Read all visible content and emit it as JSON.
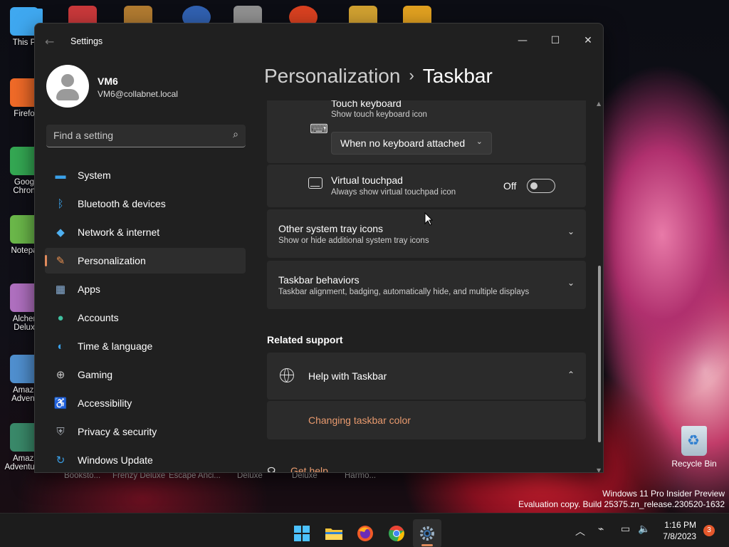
{
  "desktop": {
    "left_icons": [
      {
        "label": "This P",
        "color": "#3fa8f0"
      },
      {
        "label": "Firefo",
        "color": "#f06a28"
      },
      {
        "label": "Goog Chron",
        "color": "#34a853"
      },
      {
        "label": "Notepa",
        "color": "#6bb84a"
      },
      {
        "label": "Alcher Delux",
        "color": "#b070c0"
      },
      {
        "label": "Amazi Advent",
        "color": "#5090d0"
      },
      {
        "label": "Amazi Adventur...",
        "color": "#3a8a6a"
      }
    ],
    "bottom_labels": [
      "Booksto...",
      "Frenzy Deluxe",
      "Escape Anci...",
      "Deluxe",
      "Deluxe",
      "Harmo..."
    ],
    "recycle_bin": "Recycle Bin",
    "watermark_line1": "Windows 11 Pro Insider Preview",
    "watermark_line2": "Evaluation copy. Build 25375.zn_release.230520-1632"
  },
  "window": {
    "app_title": "Settings",
    "controls": {
      "minimize": "—",
      "maximize": "☐",
      "close": "✕"
    }
  },
  "profile": {
    "name": "VM6",
    "email": "VM6@collabnet.local"
  },
  "search": {
    "placeholder": "Find a setting"
  },
  "sidebar": {
    "items": [
      {
        "label": "System",
        "icon": "▬",
        "color": "#3aa0e8"
      },
      {
        "label": "Bluetooth & devices",
        "icon": "ᛒ",
        "color": "#3aa0e8"
      },
      {
        "label": "Network & internet",
        "icon": "◆",
        "color": "#4fb0f0"
      },
      {
        "label": "Personalization",
        "icon": "✎",
        "color": "#e89050"
      },
      {
        "label": "Apps",
        "icon": "▦",
        "color": "#8ab0d8"
      },
      {
        "label": "Accounts",
        "icon": "●",
        "color": "#40c0a0"
      },
      {
        "label": "Time & language",
        "icon": "◐",
        "color": "#3aa0e8"
      },
      {
        "label": "Gaming",
        "icon": "⊕",
        "color": "#c8c8c8"
      },
      {
        "label": "Accessibility",
        "icon": "♿",
        "color": "#3aa0e8"
      },
      {
        "label": "Privacy & security",
        "icon": "⛨",
        "color": "#9aa0a8"
      },
      {
        "label": "Windows Update",
        "icon": "↻",
        "color": "#3aa0e8"
      }
    ],
    "active_index": 3
  },
  "breadcrumb": {
    "parent": "Personalization",
    "separator": "›",
    "current": "Taskbar"
  },
  "main": {
    "touch_keyboard": {
      "title": "Touch keyboard",
      "subtitle": "Show touch keyboard icon",
      "dropdown_value": "When no keyboard attached"
    },
    "virtual_touchpad": {
      "title": "Virtual touchpad",
      "subtitle": "Always show virtual touchpad icon",
      "toggle_state": "Off"
    },
    "other_tray": {
      "title": "Other system tray icons",
      "subtitle": "Show or hide additional system tray icons"
    },
    "behaviors": {
      "title": "Taskbar behaviors",
      "subtitle": "Taskbar alignment, badging, automatically hide, and multiple displays"
    },
    "related_support": "Related support",
    "help": {
      "title": "Help with Taskbar",
      "link": "Changing taskbar color"
    },
    "get_help": "Get help"
  },
  "taskbar": {
    "time": "1:16 PM",
    "date": "7/8/2023",
    "notification_count": "3"
  }
}
